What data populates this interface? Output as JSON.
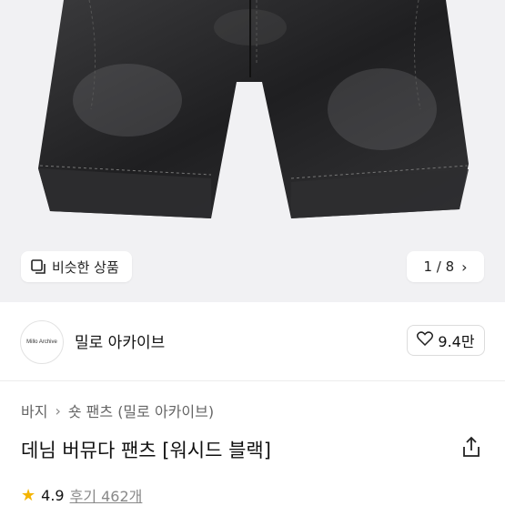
{
  "gallery": {
    "similar_label": "비슷한 상품",
    "pager_current": "1",
    "pager_sep": " / ",
    "pager_total": "8",
    "pager_next_icon": "chevron-right-icon"
  },
  "brand": {
    "logo_text": "Millo Archive",
    "name": "밀로 아카이브",
    "likes": "9.4만"
  },
  "breadcrumb": {
    "category": "바지",
    "sub": "숏 팬츠 (밀로 아카이브)"
  },
  "product": {
    "title": "데님 버뮤다 팬츠 [워시드 블랙]",
    "rating": "4.9",
    "reviews": "후기 462개"
  },
  "colors": {
    "star": "#f4b400",
    "denim": "#2a2a2c"
  }
}
